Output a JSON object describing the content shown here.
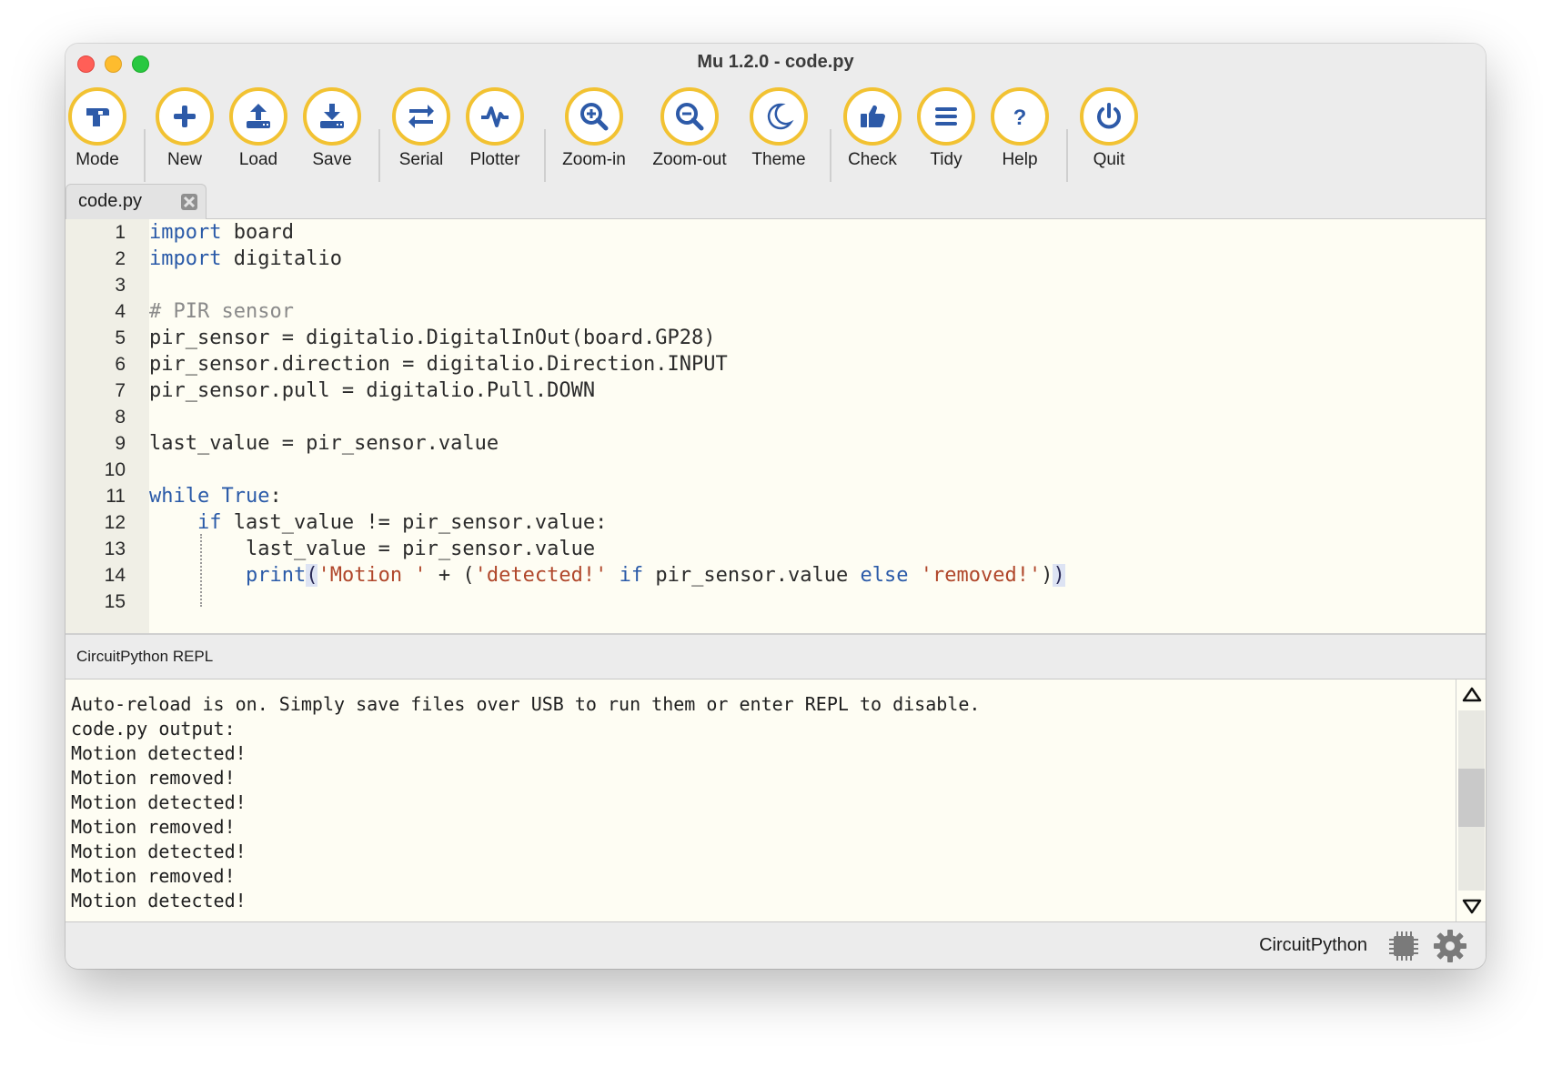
{
  "window": {
    "title": "Mu 1.2.0 - code.py"
  },
  "toolbar": {
    "buttons": [
      {
        "label": "Mode",
        "icon": "mode-icon"
      },
      {
        "label": "New",
        "icon": "plus-icon"
      },
      {
        "label": "Load",
        "icon": "upload-icon"
      },
      {
        "label": "Save",
        "icon": "download-icon"
      },
      {
        "label": "Serial",
        "icon": "arrows-icon"
      },
      {
        "label": "Plotter",
        "icon": "pulse-icon"
      },
      {
        "label": "Zoom-in",
        "icon": "zoom-in-icon"
      },
      {
        "label": "Zoom-out",
        "icon": "zoom-out-icon"
      },
      {
        "label": "Theme",
        "icon": "moon-icon"
      },
      {
        "label": "Check",
        "icon": "thumbs-up-icon"
      },
      {
        "label": "Tidy",
        "icon": "lines-icon"
      },
      {
        "label": "Help",
        "icon": "question-icon"
      },
      {
        "label": "Quit",
        "icon": "power-icon"
      }
    ]
  },
  "tabs": [
    {
      "label": "code.py"
    }
  ],
  "editor": {
    "line_numbers": [
      "1",
      "2",
      "3",
      "4",
      "5",
      "6",
      "7",
      "8",
      "9",
      "10",
      "11",
      "12",
      "13",
      "14",
      "15"
    ]
  },
  "repl": {
    "title": "CircuitPython REPL",
    "lines": [
      "Auto-reload is on. Simply save files over USB to run them or enter REPL to disable.",
      "code.py output:",
      "Motion detected!",
      "Motion removed!",
      "Motion detected!",
      "Motion removed!",
      "Motion detected!",
      "Motion removed!",
      "Motion detected!"
    ]
  },
  "status": {
    "mode": "CircuitPython"
  },
  "colors": {
    "accent": "#f2c232",
    "icon": "#2d5aa8"
  }
}
